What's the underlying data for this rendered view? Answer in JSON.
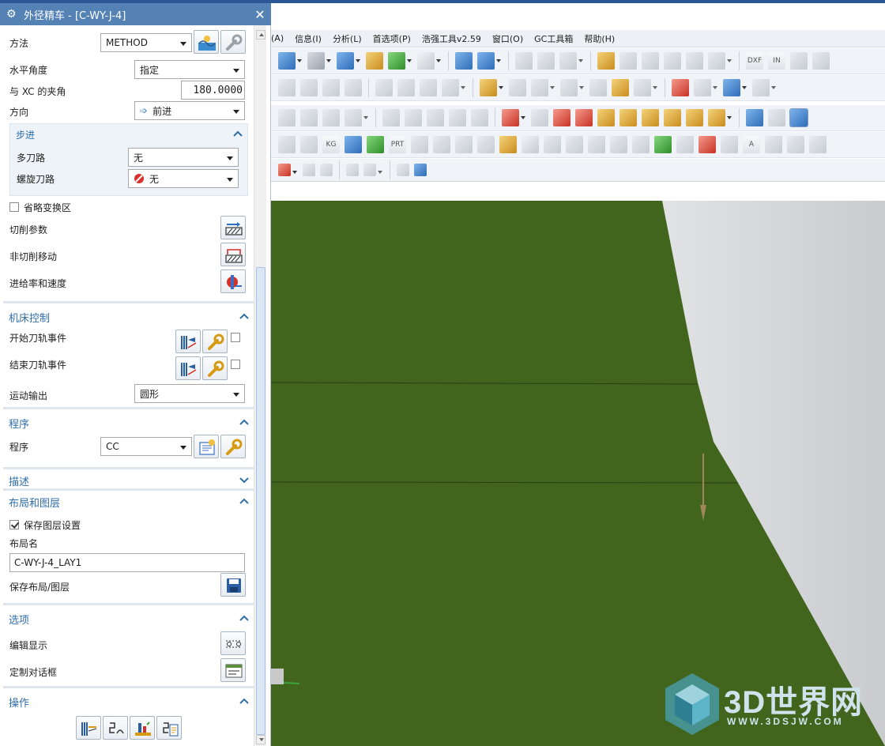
{
  "dialog": {
    "title": "外径精车 - [C-WY-J-4]",
    "method_label": "方法",
    "method_value": "METHOD",
    "angle_label": "水平角度",
    "angle_value": "指定",
    "xc_label": "与 XC 的夹角",
    "xc_value": "180.0000",
    "direction_label": "方向",
    "direction_value": "前进",
    "step_section": "步进",
    "multi_label": "多刀路",
    "multi_value": "无",
    "spiral_label": "螺旋刀路",
    "spiral_value": "无",
    "omit_label": "省略变换区",
    "cut_params_label": "切削参数",
    "non_cut_label": "非切削移动",
    "feed_label": "进给率和速度",
    "machine_section": "机床控制",
    "start_event_label": "开始刀轨事件",
    "end_event_label": "结束刀轨事件",
    "motion_label": "运动输出",
    "motion_value": "圆形",
    "program_section": "程序",
    "program_label": "程序",
    "program_value": "CC",
    "desc_section": "描述",
    "layout_section": "布局和图层",
    "save_layer_label": "保存图层设置",
    "layout_name_label": "布局名",
    "layout_name_value": "C-WY-J-4_LAY1",
    "save_layout_label": "保存布局/图层",
    "options_section": "选项",
    "edit_display_label": "编辑显示",
    "custom_dialog_label": "定制对话框",
    "ops_section": "操作"
  },
  "menu": [
    "(A)",
    "信息(I)",
    "分析(L)",
    "首选项(P)",
    "浩强工具v2.59",
    "窗口(O)",
    "GC工具箱",
    "帮助(H)"
  ],
  "watermark": {
    "title": "3D世界网",
    "url": "WWW.3DSJW.COM"
  },
  "colors": {
    "title_bar": "#5582b5",
    "section": "#2f6ea8",
    "part_green": "#41641b",
    "menu_bg": "#edf1f6"
  }
}
